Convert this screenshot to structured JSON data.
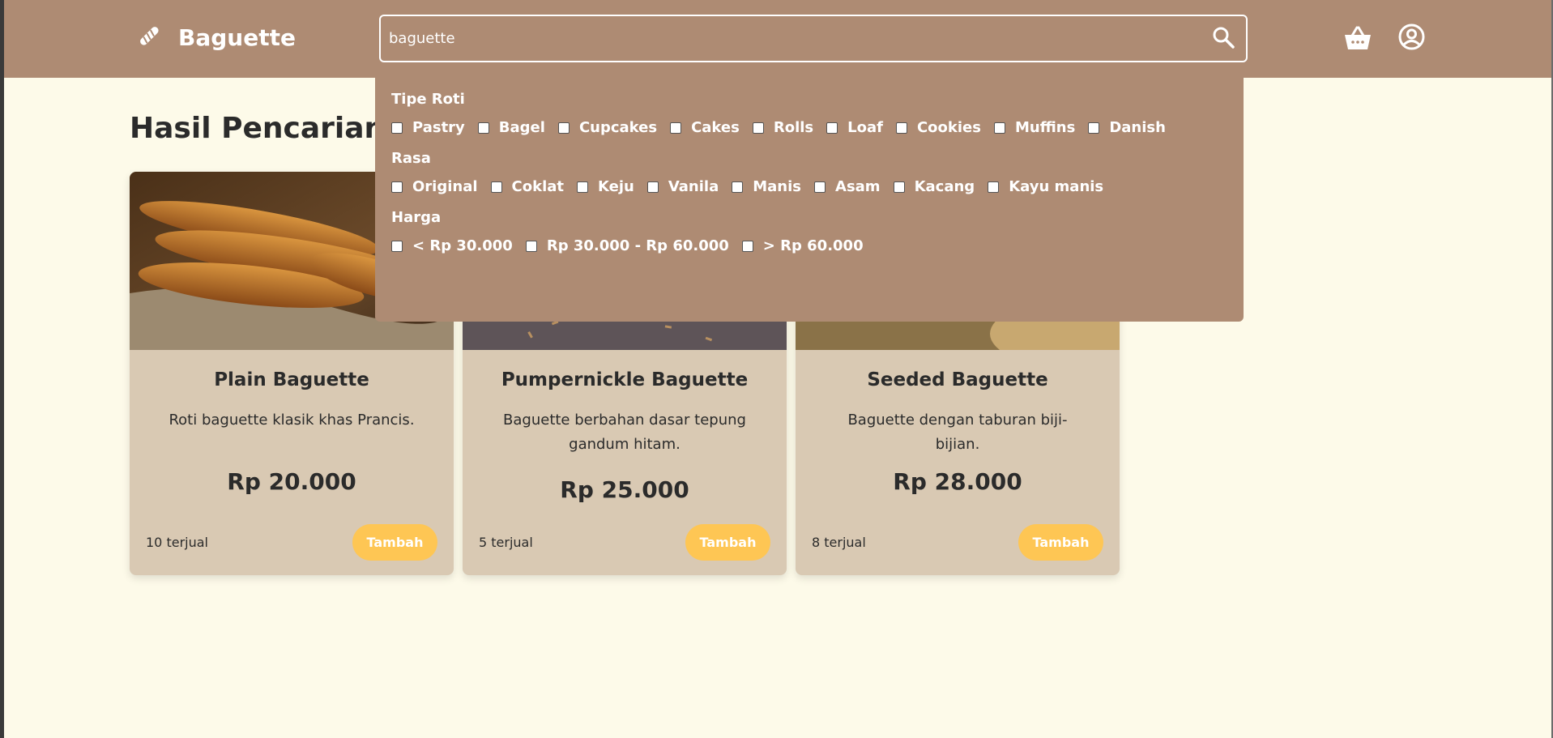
{
  "header": {
    "logo_text": "Baguette",
    "search_value": "baguette",
    "icons": [
      "baguette-logo-icon",
      "search-icon",
      "basket-icon",
      "user-icon"
    ]
  },
  "filters": {
    "groups": [
      {
        "title": "Tipe Roti",
        "options": [
          "Pastry",
          "Bagel",
          "Cupcakes",
          "Cakes",
          "Rolls",
          "Loaf",
          "Cookies",
          "Muffins",
          "Danish"
        ]
      },
      {
        "title": "Rasa",
        "options": [
          "Original",
          "Coklat",
          "Keju",
          "Vanila",
          "Manis",
          "Asam",
          "Kacang",
          "Kayu manis"
        ]
      },
      {
        "title": "Harga",
        "options": [
          "< Rp 30.000",
          "Rp 30.000 - Rp 60.000",
          "> Rp 60.000"
        ]
      }
    ]
  },
  "main": {
    "title": "Hasil Pencarian",
    "products": [
      {
        "name": "Plain Baguette",
        "description": "Roti baguette klasik khas Prancis.",
        "price": "Rp 20.000",
        "sold": "10 terjual",
        "button": "Tambah"
      },
      {
        "name": "Pumpernickle Baguette",
        "description": "Baguette berbahan dasar tepung gandum hitam.",
        "price": "Rp 25.000",
        "sold": "5 terjual",
        "button": "Tambah"
      },
      {
        "name": "Seeded Baguette",
        "description": "Baguette dengan taburan biji-bijian.",
        "price": "Rp 28.000",
        "sold": "8 terjual",
        "button": "Tambah"
      }
    ]
  },
  "colors": {
    "header": "#ae8b73",
    "background": "#fdfae9",
    "card": "#d9c9b3",
    "button": "#fec654"
  }
}
